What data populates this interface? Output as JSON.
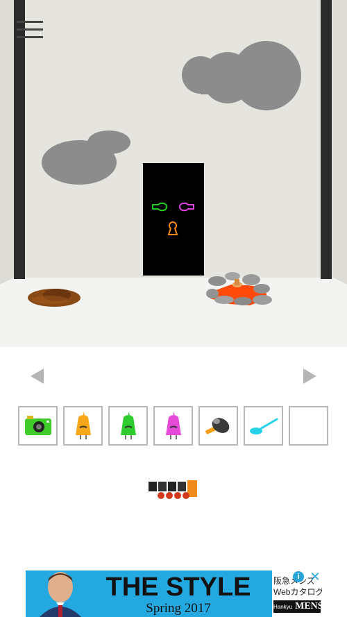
{
  "scene": {
    "name": "door room",
    "colors": {
      "wall": "#e4e3de",
      "floor": "#f2f2f0",
      "pillar": "#2b2b2b",
      "cloud": "#8c8c8c",
      "door": "#000000"
    },
    "lock_colors": {
      "left": "#22cc22",
      "right": "#e040e0",
      "keyhole": "#ff8a1a"
    }
  },
  "menu": {
    "icon": "hamburger-menu-icon"
  },
  "navigation": {
    "left_icon": "triangle-left-icon",
    "right_icon": "triangle-right-icon"
  },
  "inventory": {
    "items": [
      {
        "icon": "green-camera-icon"
      },
      {
        "icon": "orange-bell-figure-icon"
      },
      {
        "icon": "green-bell-figure-icon"
      },
      {
        "icon": "pink-bell-figure-icon"
      },
      {
        "icon": "hammer-icon"
      },
      {
        "icon": "cyan-spoon-icon"
      },
      {
        "icon": "empty-slot"
      }
    ]
  },
  "logo": {
    "icon": "game-logo-icon"
  },
  "ad": {
    "headline": "THE STYLE",
    "subline": "Spring 2017",
    "jp_line1": "阪急メンズ",
    "jp_line2": "Webカタログ",
    "brand_small": "Hankyu",
    "brand": "MENS",
    "info": "i",
    "close": "✕",
    "background": "#23a9e0"
  }
}
